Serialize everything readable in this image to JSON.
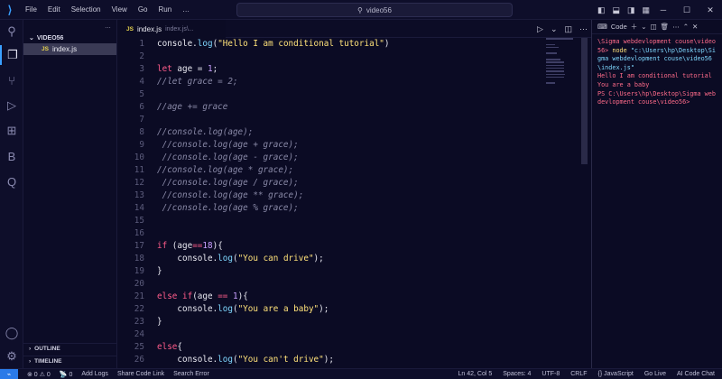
{
  "titlebar": {
    "menu": [
      "File",
      "Edit",
      "Selection",
      "View",
      "Go",
      "Run",
      "…"
    ],
    "search": "video56"
  },
  "sidebar": {
    "header": "...",
    "folder": "VIDEO56",
    "file": "index.js",
    "file_badge": "JS",
    "outline": "OUTLINE",
    "timeline": "TIMELINE"
  },
  "tabs": {
    "active": {
      "badge": "JS",
      "label": "index.js",
      "desc": "index.js\\..."
    }
  },
  "editor": {
    "lines": [
      {
        "n": "1",
        "html": "console.<span class=\"fn\">log</span>(<span class=\"str\">\"Hello I am conditional tutorial\"</span>)"
      },
      {
        "n": "2",
        "html": ""
      },
      {
        "n": "3",
        "html": "<span class=\"kw\">let</span> age = <span class=\"num\">1</span>;"
      },
      {
        "n": "4",
        "html": "<span class=\"cm\">//let grace = 2;</span>"
      },
      {
        "n": "5",
        "html": ""
      },
      {
        "n": "6",
        "html": "<span class=\"cm\">//age += grace</span>"
      },
      {
        "n": "7",
        "html": ""
      },
      {
        "n": "8",
        "html": "<span class=\"cm\">//console.log(age);</span>"
      },
      {
        "n": "9",
        "html": "<span class=\"cm\"> //console.log(age + grace);</span>"
      },
      {
        "n": "10",
        "html": "<span class=\"cm\"> //console.log(age - grace);</span>"
      },
      {
        "n": "11",
        "html": "<span class=\"cm\">//console.log(age * grace);</span>"
      },
      {
        "n": "12",
        "html": "<span class=\"cm\"> //console.log(age / grace);</span>"
      },
      {
        "n": "13",
        "html": "<span class=\"cm\"> //console.log(age ** grace);</span>"
      },
      {
        "n": "14",
        "html": "<span class=\"cm\"> //console.log(age % grace);</span>"
      },
      {
        "n": "15",
        "html": ""
      },
      {
        "n": "16",
        "html": ""
      },
      {
        "n": "17",
        "html": "<span class=\"kw\">if</span> (age<span class=\"op\">==</span><span class=\"num\">18</span>){"
      },
      {
        "n": "18",
        "html": "    console.<span class=\"fn\">log</span>(<span class=\"str\">\"You can drive\"</span>);"
      },
      {
        "n": "19",
        "html": "}"
      },
      {
        "n": "20",
        "html": ""
      },
      {
        "n": "21",
        "html": "<span class=\"kw\">else if</span>(age <span class=\"op\">==</span> <span class=\"num\">1</span>){"
      },
      {
        "n": "22",
        "html": "    console.<span class=\"fn\">log</span>(<span class=\"str\">\"You are a baby\"</span>);"
      },
      {
        "n": "23",
        "html": "}"
      },
      {
        "n": "24",
        "html": ""
      },
      {
        "n": "25",
        "html": "<span class=\"kw\">else</span>{"
      },
      {
        "n": "26",
        "html": "    console.<span class=\"fn\">log</span>(<span class=\"str\">\"You can't drive\"</span>);"
      }
    ]
  },
  "panel": {
    "title": "Code",
    "terminal": {
      "line1": "\\Sigma webdevlopment couse\\video56>",
      "cmd": " node ",
      "cmd_arg": "\"c:\\Users\\hp\\Desktop\\Sigma webdevlopment couse\\video56\\index.js\"",
      "out1": "Hello I am conditional tutorial",
      "out2": "You are a baby",
      "prompt": "PS C:\\Users\\hp\\Desktop\\Sigma webdevlopment couse\\video56>"
    }
  },
  "statusbar": {
    "errors": "⊗ 0 ⚠ 0",
    "ports": "0",
    "add_logs": "Add Logs",
    "share": "Share Code Link",
    "search_error": "Search Error",
    "position": "Ln 42, Col 5",
    "spaces": "Spaces: 4",
    "encoding": "UTF-8",
    "eol": "CRLF",
    "language": "{} JavaScript",
    "golive": "Go Live",
    "ai_chat": "AI Code Chat"
  }
}
